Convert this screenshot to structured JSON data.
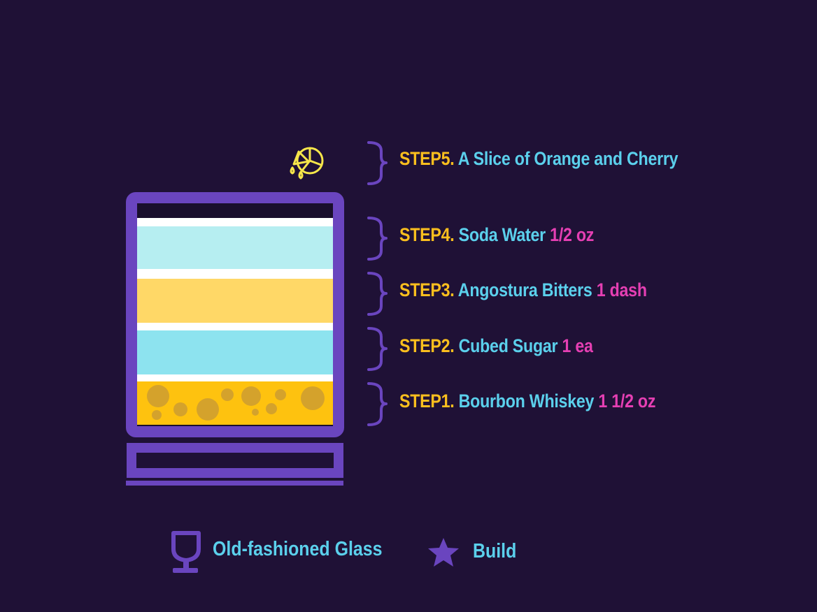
{
  "steps": [
    {
      "num": "STEP5.",
      "name": "A Slice of Orange and Cherry",
      "amount": ""
    },
    {
      "num": "STEP4.",
      "name": "Soda Water",
      "amount": "1/2 oz"
    },
    {
      "num": "STEP3.",
      "name": "Angostura Bitters",
      "amount": "1 dash"
    },
    {
      "num": "STEP2.",
      "name": "Cubed Sugar",
      "amount": "1 ea"
    },
    {
      "num": "STEP1.",
      "name": "Bourbon Whiskey",
      "amount": "1 1/2 oz"
    }
  ],
  "footer": {
    "glass_label": "Old-fashioned Glass",
    "method_label": "Build",
    "glass_icon": "wine-glass-icon",
    "method_icon": "star-icon"
  },
  "garnish_icon": "citrus-slice-icon",
  "colors": {
    "background": "#1f1136",
    "glass": "#6a45bf",
    "step_number": "#fbbf1e",
    "step_name": "#5bd0ec",
    "step_amount": "#e53fb3",
    "soda_layer": "#b6eef1",
    "bitters_layer": "#ffd867",
    "sugar_layer": "#8de3ef",
    "whiskey_layer": "#fec20f",
    "bubbles": "#d4a22c",
    "garnish": "#f6e64a"
  }
}
